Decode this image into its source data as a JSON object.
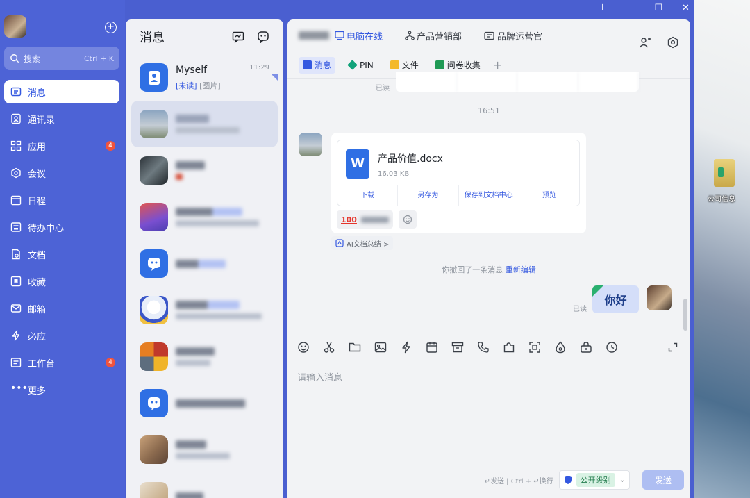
{
  "nav": {
    "search_placeholder": "搜索",
    "search_shortcut": "Ctrl + K",
    "items": [
      {
        "label": "消息",
        "active": true,
        "badge": ""
      },
      {
        "label": "通讯录",
        "badge": ""
      },
      {
        "label": "应用",
        "badge": "4"
      },
      {
        "label": "会议",
        "badge": ""
      },
      {
        "label": "日程",
        "badge": ""
      },
      {
        "label": "待办中心",
        "badge": ""
      },
      {
        "label": "文档",
        "badge": ""
      },
      {
        "label": "收藏",
        "badge": ""
      },
      {
        "label": "邮箱",
        "badge": ""
      },
      {
        "label": "必应",
        "badge": ""
      },
      {
        "label": "工作台",
        "badge": "4"
      },
      {
        "label": "更多",
        "badge": ""
      }
    ]
  },
  "list": {
    "title": "消息",
    "conversations": [
      {
        "name": "Myself",
        "sub_tag": "[未读]",
        "sub_text": " [图片]",
        "time": "11:29"
      },
      {
        "name": "",
        "sub_text": "",
        "time": ""
      },
      {
        "name": "",
        "sub_text": "",
        "time": ""
      },
      {
        "name": "",
        "sub_text": "",
        "time": ""
      },
      {
        "name": "",
        "sub_text": "",
        "time": ""
      },
      {
        "name": "",
        "sub_text": "",
        "time": ""
      },
      {
        "name": "",
        "sub_text": "",
        "time": ""
      },
      {
        "name": "",
        "sub_text": "",
        "time": ""
      },
      {
        "name": "",
        "sub_text": "",
        "time": ""
      },
      {
        "name": "",
        "sub_text": "",
        "time": ""
      }
    ]
  },
  "chat": {
    "status_online": "电脑在线",
    "dept": "产品营销部",
    "role": "品牌运营官",
    "tabs": [
      "消息",
      "PIN",
      "文件",
      "问卷收集"
    ],
    "prev_read": "已读",
    "timestamp": "16:51",
    "file": {
      "name": "产品价值.docx",
      "size": "16.03 KB",
      "actions": [
        "下载",
        "另存为",
        "保存到文档中心",
        "预览"
      ]
    },
    "ai_summary": "AI文档总结 >",
    "recall_text": "你撤回了一条消息 ",
    "recall_edit": "重新编辑",
    "my_read": "已读",
    "my_message": "你好",
    "input_placeholder": "请输入消息",
    "send_hint": "↵发送 | Ctrl + ↵换行",
    "level_label": "公开级别",
    "send_label": "发送"
  },
  "desktop": {
    "icon_label": "公司信息"
  },
  "colors": {
    "nav_bg": "#4d63d6",
    "accent": "#3458e0",
    "badge": "#f0533e"
  }
}
